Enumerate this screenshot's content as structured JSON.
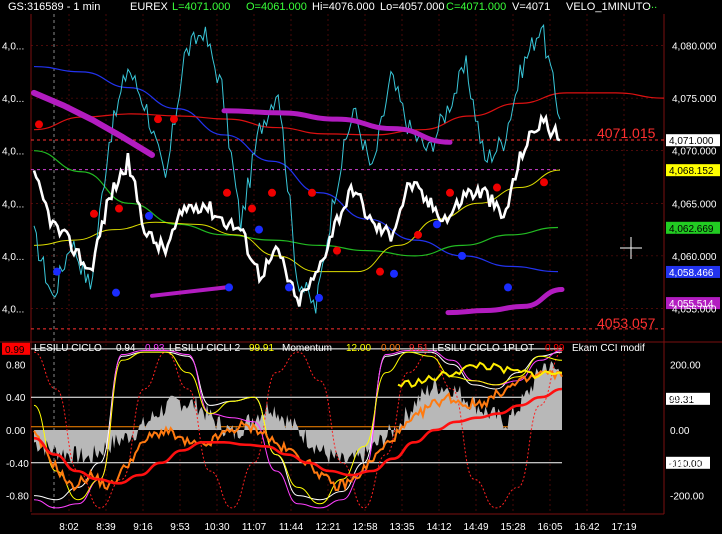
{
  "header": {
    "symbol": "GS:316589 - 1 min",
    "exchange": "EUREX",
    "last": "L=4071.000",
    "open": "O=4061.000",
    "high": "Hi=4076.000",
    "low": "Lo=4057.000",
    "close": "C=4071.000",
    "volume": "V=4071",
    "indicator": "VELO_1MINUTO",
    "dots": "..."
  },
  "colors": {
    "background": "#000000",
    "grid": "#7a1010",
    "price": "#ffffff",
    "velo": "#39c6d8",
    "magenta": "#b21cc0",
    "red": "#ff0000",
    "yellow": "#ffff00",
    "green": "#22bb22",
    "blue": "#2233ee",
    "orange": "#ff7a10"
  },
  "chart_data": [
    {
      "type": "line",
      "panel": "price",
      "yaxis_right_ticks": [
        "4,080.000",
        "4,075.000",
        "4,070.000",
        "4,065.000",
        "4,060.000",
        "4,055.000"
      ],
      "yaxis_right_values": [
        4080,
        4075,
        4070,
        4065,
        4060,
        4055
      ],
      "yaxis_left_ticks": [
        "4,0...",
        "4,0...",
        "4,0...",
        "4,0...",
        "4,0...",
        "4,0..."
      ],
      "ylim": [
        4052,
        4083
      ],
      "level_high_label": "4071.015",
      "level_high": 4071.015,
      "level_low_label": "4053.057",
      "level_low": 4053.057,
      "last_price_label": "4,071.000",
      "value_tags": [
        {
          "label": "4,071.000",
          "value": 4071.0,
          "bg": "#ffffff",
          "fg": "#000000"
        },
        {
          "label": "4,068.152",
          "value": 4068.15,
          "bg": "#ffff00",
          "fg": "#000000"
        },
        {
          "label": "4,062.669",
          "value": 4062.67,
          "bg": "#22cc22",
          "fg": "#000000"
        },
        {
          "label": "4,058.466",
          "value": 4058.47,
          "bg": "#2233ee",
          "fg": "#ffffff"
        },
        {
          "label": "4,055.514",
          "value": 4055.51,
          "bg": "#b21cc0",
          "fg": "#ffffff"
        }
      ],
      "x": [
        "8:02",
        "8:39",
        "9:16",
        "9:53",
        "10:30",
        "11:07",
        "11:44",
        "12:21",
        "12:58",
        "13:35",
        "14:12",
        "14:49",
        "15:28",
        "16:05",
        "16:42",
        "17:19"
      ],
      "series": [
        {
          "key": "price",
          "values": [
            4067.5,
            4063,
            4061,
            4058.5,
            4065.5,
            4069,
            4062,
            4060.5,
            4064.5,
            4065,
            4063.5,
            4062.5,
            4058.2,
            4060.5,
            4055.5,
            4058,
            4063,
            4066.5,
            4063,
            4062,
            4067,
            4065,
            4063.5,
            4066,
            4066,
            4063.5,
            4070,
            4073,
            4071
          ]
        },
        {
          "key": "velo",
          "values": [
            4062,
            4056,
            4061.5,
            4057,
            4071,
            4078,
            4074,
            4067,
            4079,
            4081.5,
            4076,
            4063,
            4072,
            4076,
            4058,
            4055,
            4066,
            4074,
            4068,
            4077,
            4072,
            4070,
            4074,
            4078,
            4069,
            4071,
            4078,
            4082,
            4073
          ]
        },
        {
          "key": "magenta",
          "values": [
            4075.5,
            4074,
            4072.5,
            4071,
            4069.6
          ]
        },
        {
          "key": "magenta_main",
          "values": [
            4073.8,
            4073.2,
            4072.5,
            4071.8,
            4070.5
          ]
        },
        {
          "key": "magenta_low1",
          "values": [
            4056,
            4057
          ]
        },
        {
          "key": "magenta_low2",
          "values": [
            4054.5,
            4055.5
          ]
        },
        {
          "key": "red_curve",
          "values": [
            4072,
            4073.2,
            4073.5,
            4073.3,
            4073,
            4072.2,
            4071.6,
            4071.5,
            4072,
            4073.3,
            4074.5,
            4075.5,
            4075.5,
            4075
          ]
        },
        {
          "key": "blue_curve",
          "values": [
            4078,
            4077.5,
            4076,
            4074,
            4071.5,
            4069,
            4066,
            4063.5,
            4061.5,
            4060,
            4059,
            4058.5
          ]
        },
        {
          "key": "green_curve",
          "values": [
            4070,
            4068,
            4065,
            4063,
            4062,
            4061.5,
            4061,
            4060.5,
            4060,
            4061,
            4062,
            4062.7
          ]
        },
        {
          "key": "yellow_curve",
          "values": [
            4061,
            4061.5,
            4062.5,
            4063.2,
            4063,
            4062,
            4060,
            4058.5,
            4058.5,
            4061,
            4063.5,
            4065,
            4066.5,
            4068.15
          ]
        },
        {
          "key": "dots_red",
          "values": [
            4072.5,
            4064,
            4064.5,
            4073,
            4073,
            4064.5,
            4066,
            4066,
            4060.5,
            4058.5,
            4062,
            4066,
            4066.5,
            4067,
            4075.8
          ]
        },
        {
          "key": "dots_blue",
          "values": [
            4058.5,
            4056.5,
            4063.8,
            4057,
            4062.5,
            4057,
            4056,
            4058.3,
            4063,
            4060,
            4057,
            4060.5
          ]
        }
      ]
    },
    {
      "type": "line",
      "panel": "oscillators",
      "legend": [
        {
          "label": "LESILU CICLO",
          "color": "#ffffff"
        },
        {
          "label": "0.94",
          "color": "#ffffff"
        },
        {
          "label": "0.93",
          "color": "#ff40ff"
        },
        {
          "label": "LESILU CICLI 2",
          "color": "#ffffff"
        },
        {
          "label": "99.91",
          "color": "#ffff00"
        },
        {
          "label": "Momentum",
          "color": "#ffffff"
        },
        {
          "label": "12.00",
          "color": "#ffff00"
        },
        {
          "label": "0.00",
          "color": "#ff7a10"
        },
        {
          "label": "9.51",
          "color": "#ff3030"
        },
        {
          "label": "LESILU CICLO 1PLOT",
          "color": "#ffffff"
        },
        {
          "label": "0.99",
          "color": "#ff0000"
        },
        {
          "label": "Ekam CCI modif",
          "color": "#ffffff"
        }
      ],
      "yaxis_left_ticks": [
        "0.80",
        "0.40",
        "0.00",
        "-0.40",
        "-0.80"
      ],
      "yaxis_left_values": [
        0.8,
        0.4,
        0.0,
        -0.4,
        -0.8
      ],
      "yaxis_right_ticks": [
        "200.00",
        "100.00",
        "0.00",
        "-100.00",
        "-200.00"
      ],
      "yaxis_right_values": [
        200,
        100,
        0,
        -100,
        -200
      ],
      "ylim": [
        -1.0,
        1.0
      ],
      "value_tags": [
        {
          "label": "0.99",
          "side": "left",
          "value": 0.99,
          "bg": "#ff0000",
          "fg": "#000000"
        },
        {
          "label": "99.31",
          "side": "right",
          "value": 0.38,
          "bg": "#ffffff",
          "fg": "#000000"
        },
        {
          "label": "-110.00",
          "side": "right",
          "value": -0.4,
          "bg": "#ffffff",
          "fg": "#000000"
        }
      ],
      "hlines": [
        0.99,
        0.4,
        0.04,
        -0.4
      ],
      "series": [
        {
          "key": "hist_gray",
          "values": [
            -0.15,
            -0.25,
            -0.3,
            -0.35,
            -0.2,
            -0.1,
            0.05,
            0.25,
            0.35,
            0.3,
            0.1,
            -0.05,
            0.15,
            0.3,
            0.1,
            -0.1,
            -0.3,
            -0.4,
            -0.35,
            -0.15,
            0.05,
            0.35,
            0.55,
            0.5,
            0.35,
            0.2,
            0.1,
            0.4,
            0.8,
            0.7
          ]
        },
        {
          "key": "orange_fast",
          "values": [
            -0.05,
            -0.4,
            -0.7,
            -0.55,
            -0.7,
            -0.4,
            -0.1,
            0.0,
            -0.15,
            -0.2,
            -0.05,
            0.05,
            0.0,
            -0.2,
            -0.3,
            -0.5,
            -0.7,
            -0.6,
            -0.35,
            -0.1,
            0.1,
            0.3,
            0.4,
            0.3,
            0.35,
            0.5,
            0.6,
            0.7,
            0.65
          ]
        },
        {
          "key": "red_slow",
          "values": [
            -0.1,
            -0.3,
            -0.5,
            -0.6,
            -0.65,
            -0.55,
            -0.4,
            -0.25,
            -0.15,
            -0.15,
            -0.18,
            -0.2,
            -0.3,
            -0.4,
            -0.5,
            -0.55,
            -0.5,
            -0.35,
            -0.15,
            0.0,
            0.1,
            0.15,
            0.2,
            0.3,
            0.4,
            0.5
          ]
        },
        {
          "key": "white_cycle",
          "values": [
            -0.8,
            -0.85,
            -0.7,
            -0.4,
            0.9,
            0.95,
            0.95,
            0.9,
            0.3,
            0.35,
            0.4,
            -0.3,
            -0.8,
            -0.85,
            -0.75,
            -0.4,
            0.9,
            0.95,
            0.95,
            0.8,
            0.55,
            0.5,
            0.7,
            0.9,
            0.95
          ]
        },
        {
          "key": "magenta_cycle",
          "values": [
            -0.85,
            -0.95,
            -0.9,
            -0.6,
            0.92,
            0.97,
            0.97,
            0.92,
            0.2,
            0.15,
            0.1,
            -0.5,
            -0.9,
            -0.95,
            -0.85,
            -0.5,
            0.92,
            0.97,
            0.97,
            0.85,
            0.6,
            0.55,
            0.6,
            0.85,
            0.97
          ]
        },
        {
          "key": "yellow_cci",
          "values": [
            0.3,
            -0.5,
            -0.85,
            -0.6,
            0.85,
            0.95,
            0.95,
            0.7,
            0.2,
            0.35,
            0.4,
            -0.3,
            -0.7,
            -0.9,
            -0.6,
            -0.2,
            0.7,
            0.95,
            0.9,
            0.65,
            0.6,
            0.55,
            0.65,
            0.9,
            0.85
          ]
        },
        {
          "key": "red_dotted",
          "values": [
            0.95,
            0.5,
            -0.5,
            -0.95,
            -0.6,
            0.5,
            0.95,
            0.5,
            -0.5,
            -0.95,
            -0.4,
            0.7,
            0.95,
            0.6,
            -0.4,
            -0.95,
            -0.3,
            0.7,
            0.95,
            0.5,
            -0.6,
            -0.95,
            -0.7,
            0.3,
            0.95
          ]
        }
      ]
    }
  ]
}
